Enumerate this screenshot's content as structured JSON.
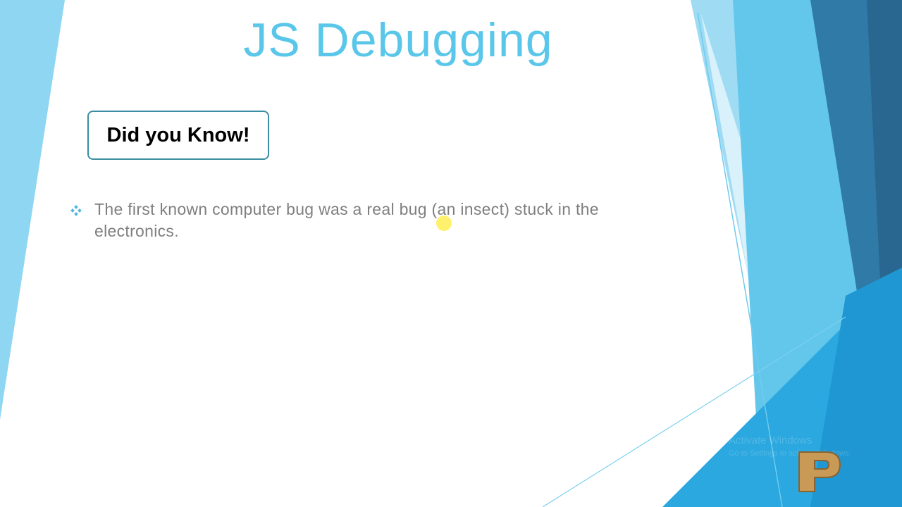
{
  "slide": {
    "title": "JS Debugging",
    "callout": "Did you Know!",
    "bullet_text": "The first known computer bug was a real bug (an insect) stuck in the electronics."
  },
  "watermark": {
    "line1": "Activate Windows",
    "line2": "Go to Settings to activate Windows."
  },
  "colors": {
    "title": "#5ac7ea",
    "callout_border": "#3d8ea3",
    "bullet_text": "#7f7f7f",
    "accent_light": "#8fd6f2",
    "accent_mid": "#35b3e3",
    "accent_dark": "#2f6e97"
  },
  "icons": {
    "bullet": "diamond-bullet-icon",
    "logo": "p-logo-icon"
  }
}
